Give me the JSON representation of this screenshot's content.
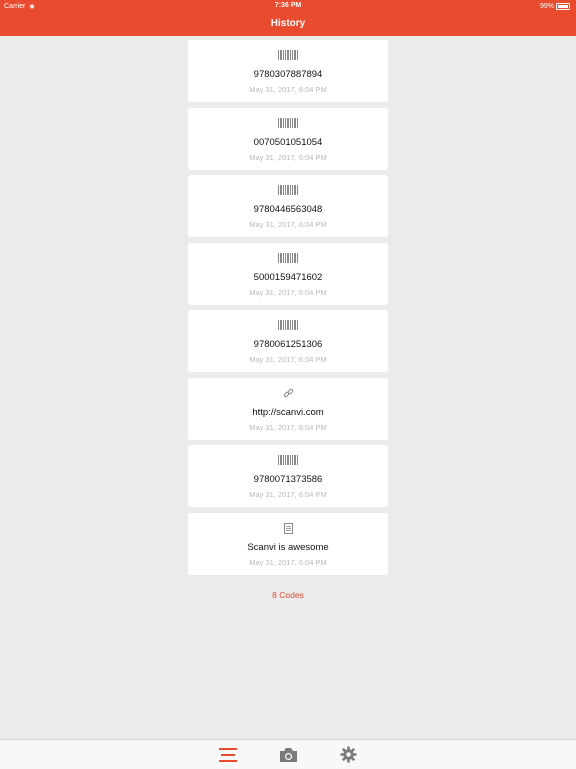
{
  "status": {
    "carrier": "Carrier",
    "time": "7:36 PM",
    "battery": "99%"
  },
  "header": {
    "title": "History"
  },
  "items": [
    {
      "code": "9780307887894",
      "date": "May 31, 2017, 6:04 PM",
      "type": "barcode-icon"
    },
    {
      "code": "0070501051054",
      "date": "May 31, 2017, 6:04 PM",
      "type": "barcode-icon"
    },
    {
      "code": "9780446563048",
      "date": "May 31, 2017, 6:04 PM",
      "type": "barcode-icon"
    },
    {
      "code": "5000159471602",
      "date": "May 31, 2017, 6:04 PM",
      "type": "barcode-icon"
    },
    {
      "code": "9780061251306",
      "date": "May 31, 2017, 6:04 PM",
      "type": "barcode-icon"
    },
    {
      "code": "http://scanvi.com",
      "date": "May 31, 2017, 6:04 PM",
      "type": "link-icon"
    },
    {
      "code": "9780071373586",
      "date": "May 31, 2017, 6:04 PM",
      "type": "barcode-icon"
    },
    {
      "code": "Scanvi is awesome",
      "date": "May 31, 2017, 6:04 PM",
      "type": "document-icon"
    }
  ],
  "footer": {
    "count_label": "8 Codes"
  },
  "tabs": [
    {
      "icon": "list-icon",
      "active": true
    },
    {
      "icon": "camera-icon",
      "active": false
    },
    {
      "icon": "gear-icon",
      "active": false
    }
  ],
  "colors": {
    "accent": "#e84b2e",
    "background": "#ebebeb",
    "date": "#b9b9b9"
  }
}
